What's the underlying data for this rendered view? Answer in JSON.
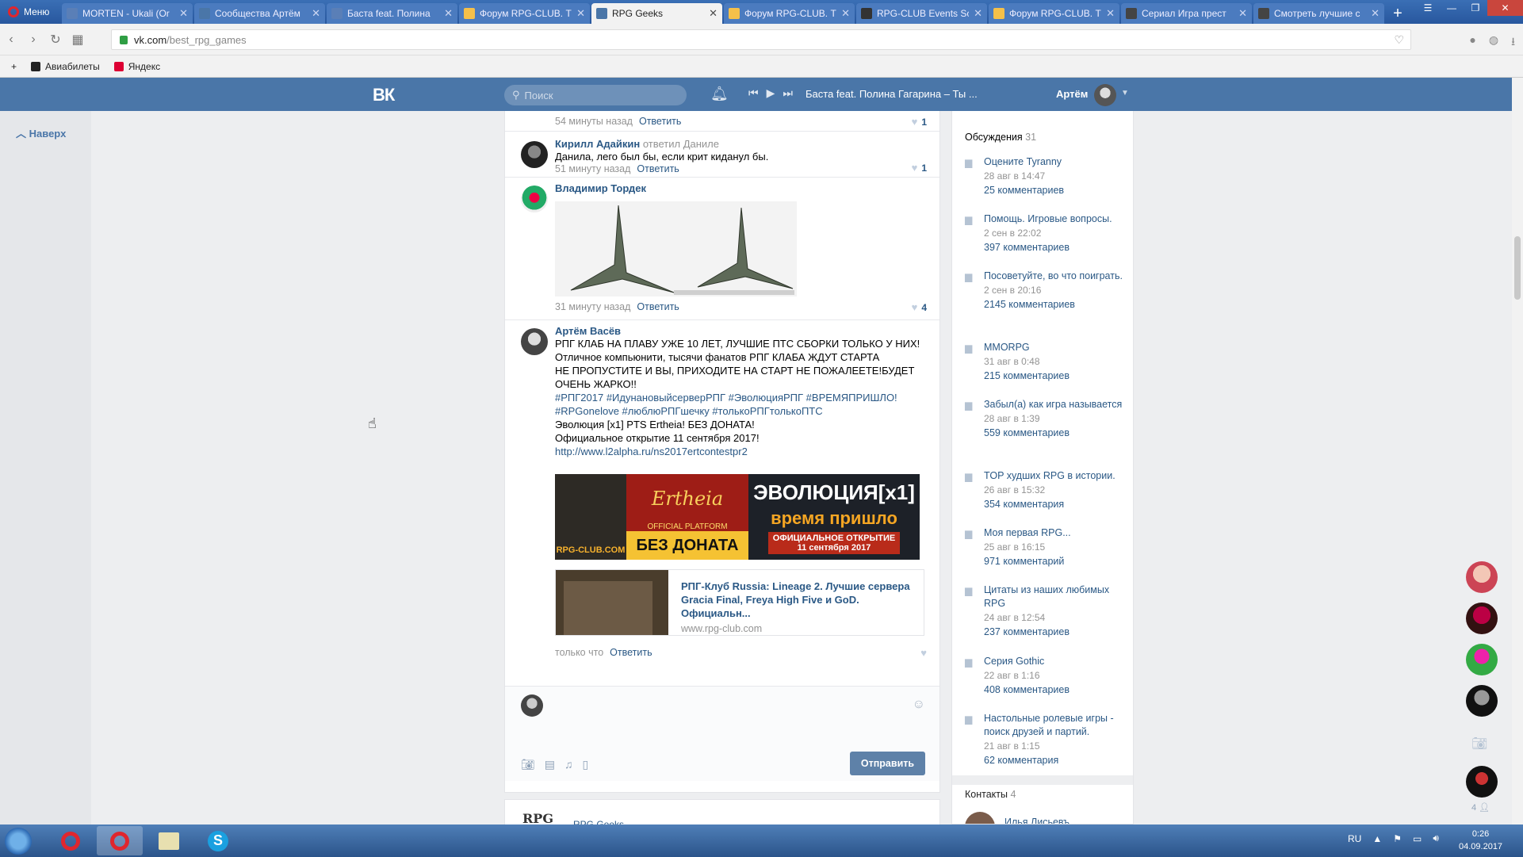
{
  "browser": {
    "menu_label": "Меню",
    "tabs": [
      {
        "label": "MORTEN - Ukali (Or",
        "fav": "yt"
      },
      {
        "label": "Сообщества Артём",
        "fav": "vk"
      },
      {
        "label": "Баста feat. Полина",
        "fav": "yt"
      },
      {
        "label": "Форум RPG-CLUB. Т",
        "fav": "rpg"
      },
      {
        "label": "RPG Geeks",
        "fav": "vk",
        "active": true
      },
      {
        "label": "Форум RPG-CLUB. Т",
        "fav": "rpg"
      },
      {
        "label": "RPG-CLUB Events Sc",
        "fav": "dark"
      },
      {
        "label": "Форум RPG-CLUB. Т",
        "fav": "rpg"
      },
      {
        "label": "Сериал Игра прест",
        "fav": "film"
      },
      {
        "label": "Смотреть лучшие с",
        "fav": "film"
      }
    ],
    "url_host": "vk.com",
    "url_path": "/best_rpg_games",
    "bookmarks": [
      "Авиабилеты",
      "Яндекс"
    ]
  },
  "vk_header": {
    "logo": "ВК",
    "search_placeholder": "Поиск",
    "track": "Баста feat. Полина Гагарина – Ты ...",
    "user_name": "Артём"
  },
  "left": {
    "up_label": "Наверх"
  },
  "comments": [
    {
      "meta_time": "54 минуты назад",
      "reply": "Ответить",
      "likes": "1"
    },
    {
      "author": "Кирилл Адайкин",
      "reply_to": "ответил Даниле",
      "text": "Данила, лего был бы, если крит киданул бы.",
      "meta_time": "51 минуту назад",
      "reply": "Ответить",
      "likes": "1"
    },
    {
      "author": "Владимир Тордек",
      "meta_time": "31 минуту назад",
      "reply": "Ответить",
      "likes": "4"
    },
    {
      "author": "Артём Васёв",
      "lines": [
        "РПГ КЛАБ НА ПЛАВУ УЖЕ 10 ЛЕТ, ЛУЧШИЕ ПТС СБОРКИ ТОЛЬКО У НИХ!",
        "Отличное компьюнити, тысячи фанатов РПГ КЛАБА ЖДУТ СТАРТА",
        "НЕ ПРОПУСТИТЕ И ВЫ, ПРИХОДИТЕ НА СТАРТ НЕ ПОЖАЛЕЕТЕ!БУДЕТ",
        "ОЧЕНЬ ЖАРКО!!"
      ],
      "hashtags1": "#РПГ2017 #ИдунановыйсерверРПГ #ЭволюцияРПГ #ВРЕМЯПРИШЛО!",
      "hashtags2": "#RPGonelove #люблюРПГшечку #толькоРПГтолькоПТС",
      "line_evo": "Эволюция [x1] PTS Ertheia! БЕЗ ДОНАТА!",
      "line_open": "Официальное открытие 11 сентября 2017!",
      "link": "http://www.l2alpha.ru/ns2017ertcontestpr2",
      "banner": {
        "logo": "RPG-CLUB.COM",
        "ertheia": "Ertheia",
        "official": "OFFICIAL PLATFORM",
        "no_donate": "БЕЗ ДОНАТА",
        "evo": "ЭВОЛЮЦИЯ[x1]",
        "time": "время пришло",
        "open1": "ОФИЦИАЛЬНОЕ ОТКРЫТИЕ",
        "open2": "11 сентября 2017"
      },
      "share_title": "РПГ-Клуб Russia: Lineage 2. Лучшие сервера Gracia Final, Freya High Five и GoD. Официальн...",
      "share_domain": "www.rpg-club.com",
      "meta_time": "только что",
      "reply": "Ответить"
    }
  ],
  "composer": {
    "send_label": "Отправить"
  },
  "next_post": {
    "logo": "RPG",
    "group": "RPG Geeks"
  },
  "sidebar": {
    "discussions_label": "Обсуждения",
    "discussions_count": "31",
    "topics": [
      {
        "title": "Оцените Tyranny",
        "date": "28 авг в 14:47",
        "count": "25 комментариев"
      },
      {
        "title": "Помощь. Игровые вопросы.",
        "date": "2 сен в 22:02",
        "count": "397 комментариев"
      },
      {
        "title": "Посоветуйте, во что поиграть.",
        "date": "2 сен в 20:16",
        "count": "2145 комментариев"
      },
      {
        "title": "MMORPG",
        "date": "31 авг в 0:48",
        "count": "215 комментариев"
      },
      {
        "title": "Забыл(а) как игра называется",
        "date": "28 авг в 1:39",
        "count": "559 комментариев"
      },
      {
        "title": "TOP худших RPG в истории.",
        "date": "26 авг в 15:32",
        "count": "354 комментария"
      },
      {
        "title": "Моя первая RPG...",
        "date": "25 авг в 16:15",
        "count": "971 комментарий"
      },
      {
        "title": "Цитаты из наших любимых RPG",
        "date": "24 авг в 12:54",
        "count": "237 комментариев"
      },
      {
        "title": "Серия Gothic",
        "date": "22 авг в 1:16",
        "count": "408 комментариев"
      },
      {
        "title": "Настольные ролевые игры - поиск друзей и партий.",
        "date": "21 авг в 1:15",
        "count": "62 комментария"
      }
    ],
    "contacts_label": "Контакты",
    "contacts_count": "4",
    "contact_name": "Илья Лисьевъ"
  },
  "friends_bar": {
    "count": "4"
  },
  "taskbar": {
    "lang": "RU",
    "time": "0:26",
    "date": "04.09.2017"
  },
  "colors": {
    "vk_blue": "#4a76a8",
    "link": "#2a5885",
    "send_button": "#5e81a8"
  }
}
